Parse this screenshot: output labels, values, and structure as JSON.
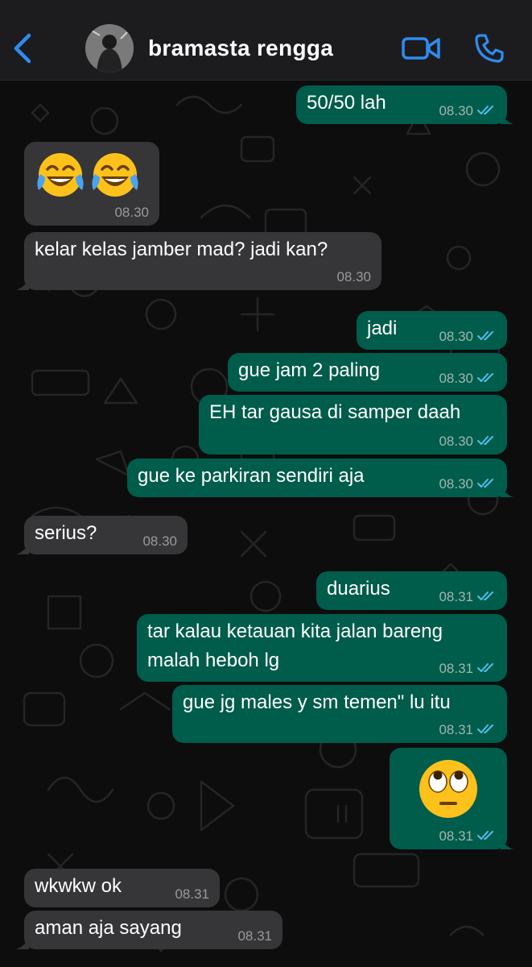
{
  "header": {
    "contact_name": "bramasta rengga",
    "back_icon": "chevron-left-icon",
    "video_icon": "video-camera-icon",
    "call_icon": "phone-icon",
    "accent_color": "#2f8cf0"
  },
  "colors": {
    "outgoing_bubble": "#005c4b",
    "incoming_bubble": "#363638",
    "read_ticks": "#53bdeb"
  },
  "messages": [
    {
      "dir": "out",
      "text": "50/50 lah",
      "time": "08.30",
      "read": true
    },
    {
      "dir": "in",
      "emoji": "face-with-tears-of-joy x2",
      "time": "08.30"
    },
    {
      "dir": "in",
      "text": "kelar kelas jamber mad? jadi kan?",
      "time": "08.30"
    },
    {
      "dir": "out",
      "text": "jadi",
      "time": "08.30",
      "read": true
    },
    {
      "dir": "out",
      "text": "gue jam 2 paling",
      "time": "08.30",
      "read": true
    },
    {
      "dir": "out",
      "text": "EH tar gausa di samper daah",
      "time": "08.30",
      "read": true
    },
    {
      "dir": "out",
      "text": "gue ke parkiran sendiri aja",
      "time": "08.30",
      "read": true
    },
    {
      "dir": "in",
      "text": "serius?",
      "time": "08.30"
    },
    {
      "dir": "out",
      "text": "duarius",
      "time": "08.31",
      "read": true
    },
    {
      "dir": "out",
      "text_line1": "tar kalau ketauan kita jalan bareng",
      "text_line2": "malah heboh lg",
      "time": "08.31",
      "read": true
    },
    {
      "dir": "out",
      "text": "gue jg males y sm temen\" lu itu",
      "time": "08.31",
      "read": true
    },
    {
      "dir": "out",
      "emoji": "face-with-rolling-eyes",
      "time": "08.31",
      "read": true
    },
    {
      "dir": "in",
      "text": "wkwkw ok",
      "time": "08.31"
    },
    {
      "dir": "in",
      "text": "aman aja sayang",
      "time": "08.31"
    }
  ]
}
